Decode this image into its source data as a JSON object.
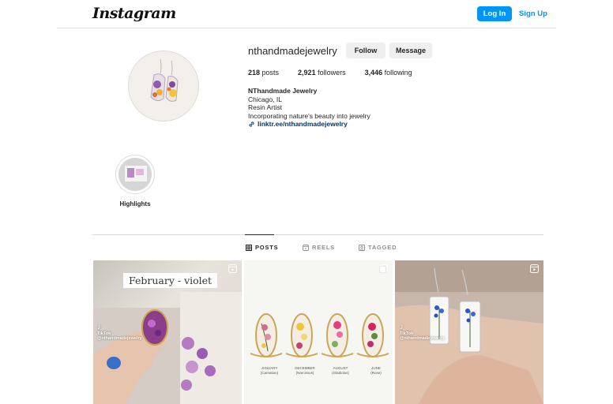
{
  "header": {
    "logo": "Instagram",
    "login_label": "Log In",
    "signup_label": "Sign Up"
  },
  "profile": {
    "username": "nthandmadejewelry",
    "follow_label": "Follow",
    "message_label": "Message",
    "posts_count": "218",
    "posts_label": " posts",
    "followers_count": "2,921",
    "followers_label": " followers",
    "following_count": "3,446",
    "following_label": " following",
    "display_name": "NThandmade Jewelry",
    "location": "Chicago, IL",
    "role": "Resin Artist",
    "bio": "Incorporating nature's beauty into jewelry",
    "link": "linktr.ee/nthandmadejewelry"
  },
  "highlights": [
    {
      "label": "Highlights"
    }
  ],
  "tabs": [
    {
      "label": "POSTS",
      "active": true,
      "icon": "grid-icon"
    },
    {
      "label": "REELS",
      "active": false,
      "icon": "reels-icon"
    },
    {
      "label": "TAGGED",
      "active": false,
      "icon": "tagged-icon"
    }
  ],
  "posts": [
    {
      "caption": "February - violet",
      "tiktok": "TikTok",
      "tiktok_handle": "@nthandmadejewelry",
      "icon": "reel-icon"
    },
    {
      "months": [
        "JANUARY",
        "DECEMBER",
        "AUGUST",
        "JUNE"
      ],
      "flowers": [
        "(Carnation)",
        "(Narcissus)",
        "(Gladiolus)",
        "(Rose)"
      ],
      "icon": "carousel-icon"
    },
    {
      "tiktok": "TikTok",
      "tiktok_handle": "@nthandmadejewelry",
      "icon": "reel-icon"
    }
  ],
  "colors": {
    "accent": "#0095f6",
    "link": "#00376b",
    "button_bg": "#efefef",
    "divider": "#dbdbdb"
  }
}
